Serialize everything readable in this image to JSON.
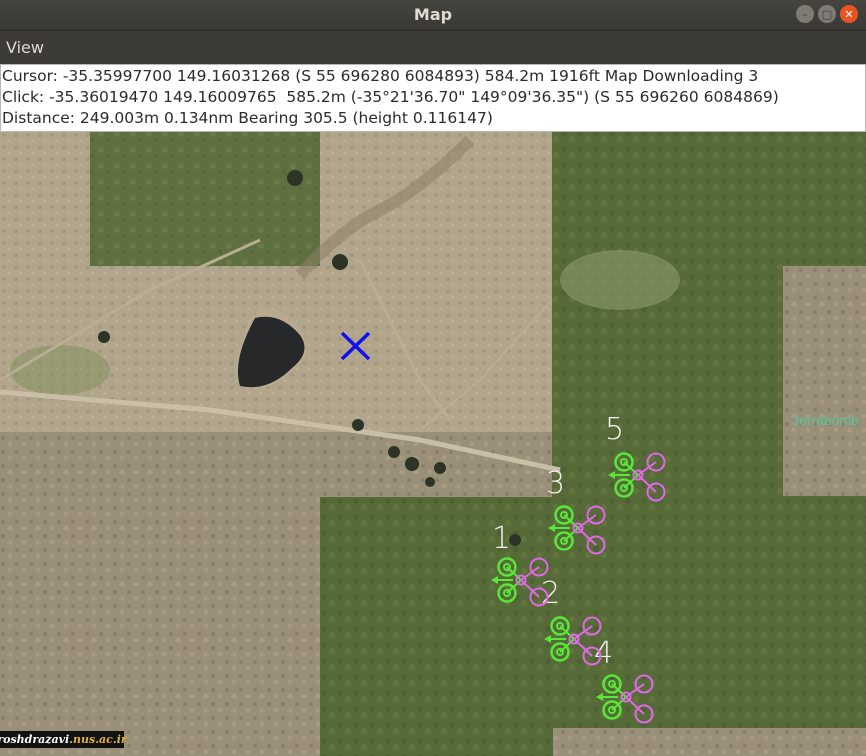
{
  "window": {
    "title": "Map"
  },
  "menu": {
    "view": "View"
  },
  "info": {
    "cursor": "Cursor: -35.35997700 149.16031268 (S 55 696280 6084893) 584.2m 1916ft Map Downloading 3",
    "click": "Click: -35.36019470 149.16009765  585.2m (-35°21'36.70\" 149°09'36.35\") (S 55 696260 6084869)",
    "distance": "Distance: 249.003m 0.134nm Bearing 305.5 (height 0.116147)"
  },
  "map": {
    "place_label": "Jerrabomb",
    "vehicle_labels": [
      "1",
      "2",
      "3",
      "4",
      "5"
    ]
  },
  "watermark": {
    "prefix": "roshdrazavi",
    "suffix": ".nus.ac.ir"
  },
  "colors": {
    "click_marker": "#1010ee",
    "rotor_green": "#58e838",
    "rotor_magenta": "#e068e8"
  },
  "icons": {
    "click_marker": "x-cross-icon",
    "vehicle": "quadcopter-icon",
    "minimize": "minimize-icon",
    "maximize": "maximize-icon",
    "close": "close-icon"
  }
}
